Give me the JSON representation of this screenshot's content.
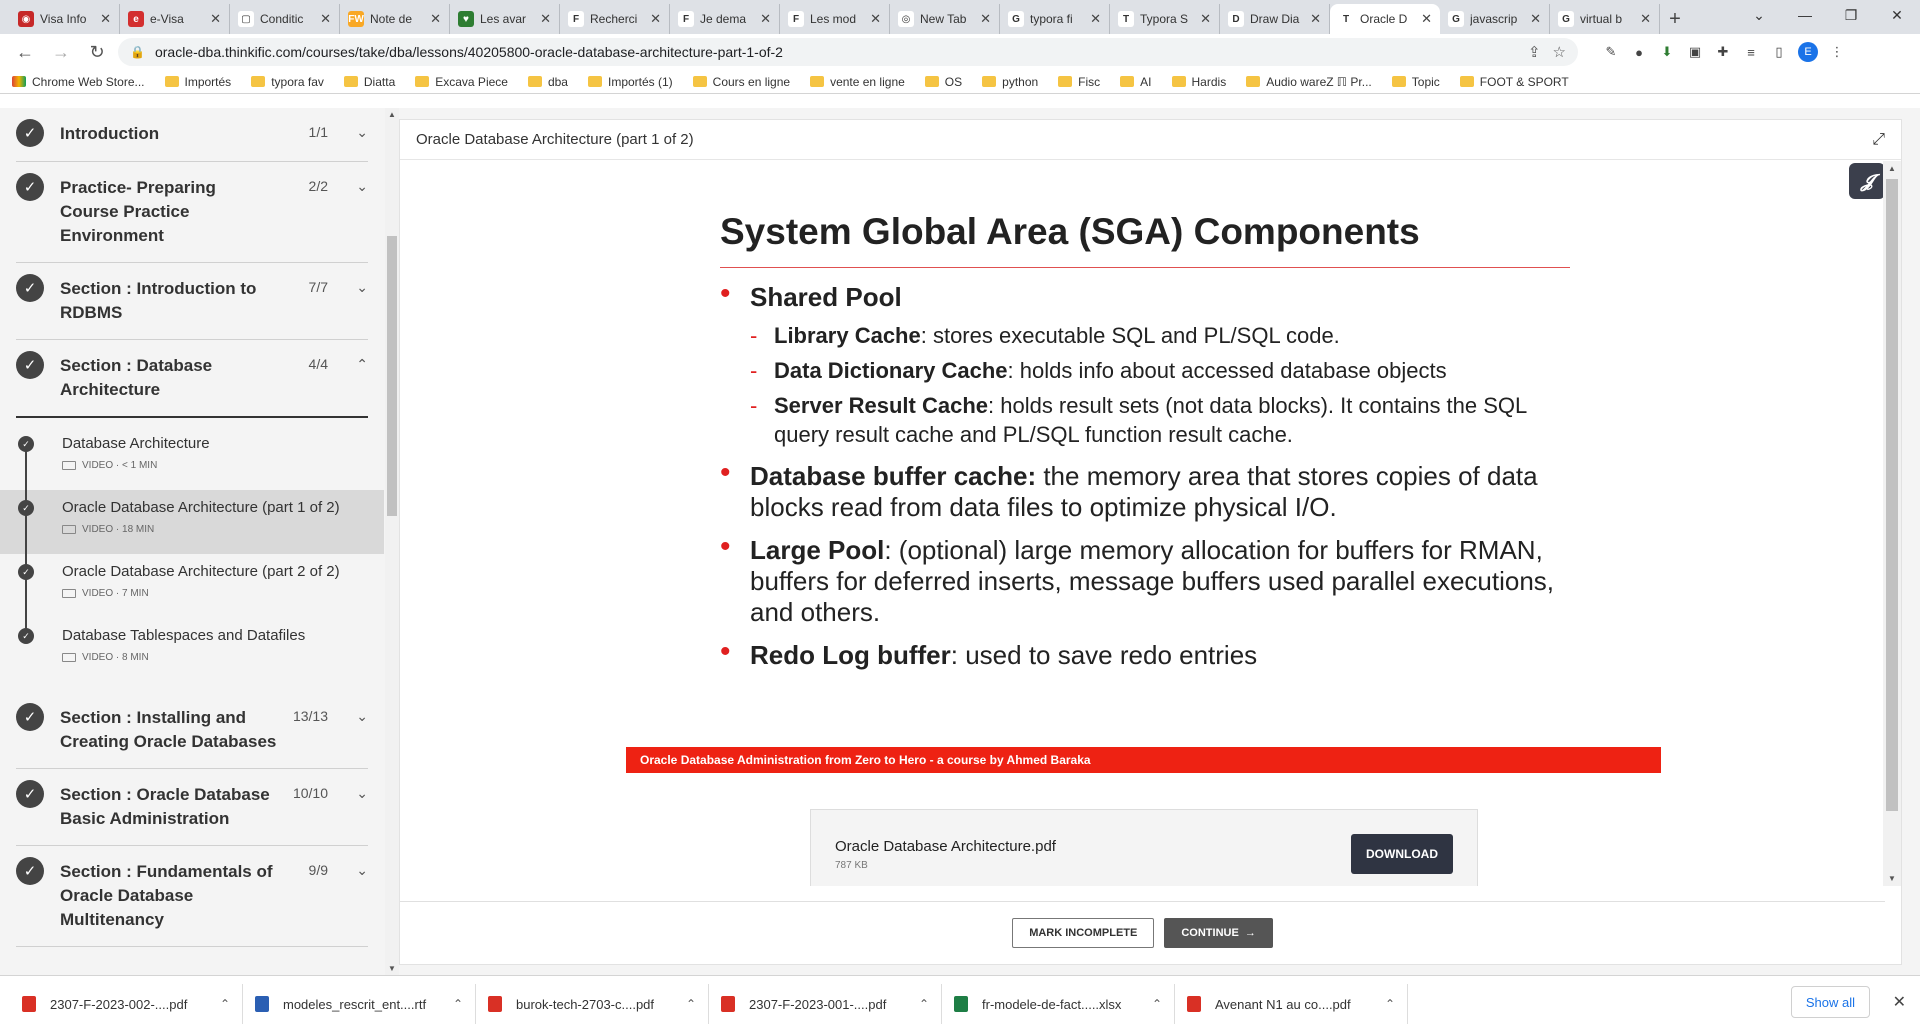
{
  "browser": {
    "tabs": [
      {
        "title": "Visa Info",
        "color": "#c62828",
        "glyph": "◉"
      },
      {
        "title": "e-Visa",
        "color": "#d32f2f",
        "glyph": "e"
      },
      {
        "title": "Conditic",
        "color": "#fff",
        "glyph": "▢"
      },
      {
        "title": "Note de",
        "color": "#f9a825",
        "glyph": "FW"
      },
      {
        "title": "Les avar",
        "color": "#2e7d32",
        "glyph": "♥"
      },
      {
        "title": "Recherci",
        "color": "#fff",
        "glyph": "F"
      },
      {
        "title": "Je dema",
        "color": "#fff",
        "glyph": "F"
      },
      {
        "title": "Les mod",
        "color": "#fff",
        "glyph": "F"
      },
      {
        "title": "New Tab",
        "color": "#fff",
        "glyph": "◎"
      },
      {
        "title": "typora fi",
        "color": "#fff",
        "glyph": "G"
      },
      {
        "title": "Typora S",
        "color": "#fff",
        "glyph": "T"
      },
      {
        "title": "Draw Dia",
        "color": "#fff",
        "glyph": "D"
      },
      {
        "title": "Oracle D",
        "color": "#fff",
        "glyph": "T",
        "active": true
      },
      {
        "title": "javascrip",
        "color": "#fff",
        "glyph": "G"
      },
      {
        "title": "virtual b",
        "color": "#fff",
        "glyph": "G"
      }
    ],
    "url": "oracle-dba.thinkific.com/courses/take/dba/lessons/40205800-oracle-database-architecture-part-1-of-2",
    "profile_initial": "E",
    "bookmarks": [
      "Chrome Web Store...",
      "Importés",
      "typora fav",
      "Diatta",
      "Excava Piece",
      "dba",
      "Importés (1)",
      "Cours en ligne",
      "vente en ligne",
      "OS",
      "python",
      "Fisc",
      "AI",
      "Hardis",
      "Audio wareZ ℿ Pr...",
      "Topic",
      "FOOT & SPORT"
    ]
  },
  "sidebar": {
    "sections": [
      {
        "title": "Introduction",
        "count": "1/1",
        "open": false
      },
      {
        "title": "Practice- Preparing Course Practice Environment",
        "count": "2/2",
        "open": false
      },
      {
        "title": "Section : Introduction to RDBMS",
        "count": "7/7",
        "open": false
      },
      {
        "title": "Section : Database Architecture",
        "count": "4/4",
        "open": true
      },
      {
        "title": "Section : Installing and Creating Oracle Databases",
        "count": "13/13",
        "open": false
      },
      {
        "title": "Section : Oracle Database Basic Administration",
        "count": "10/10",
        "open": false
      },
      {
        "title": "Section : Fundamentals of Oracle Database Multitenancy",
        "count": "9/9",
        "open": false
      }
    ],
    "lessons": [
      {
        "title": "Database Architecture",
        "meta": "VIDEO · < 1 MIN"
      },
      {
        "title": "Oracle Database Architecture (part 1 of 2)",
        "meta": "VIDEO · 18 MIN",
        "active": true
      },
      {
        "title": "Oracle Database Architecture (part 2 of 2)",
        "meta": "VIDEO · 7 MIN"
      },
      {
        "title": "Database Tablespaces and Datafiles",
        "meta": "VIDEO · 8 MIN"
      }
    ]
  },
  "content": {
    "header_title": "Oracle Database Architecture (part 1 of 2)",
    "slide": {
      "title": "System Global Area (SGA) Components",
      "shared_pool": "Shared Pool",
      "lib_cache_b": "Library Cache",
      "lib_cache_t": ": stores executable SQL and PL/SQL code.",
      "dict_cache_b": "Data Dictionary Cache",
      "dict_cache_t": ": holds info about accessed database objects",
      "result_cache_b": "Server Result Cache",
      "result_cache_t": ":  holds result sets (not data blocks). It contains the SQL query result cache and PL/SQL function result cache.",
      "buffer_b": "Database buffer cache:",
      "buffer_t": " the memory area that stores copies of data blocks read from data files to optimize physical I/O.",
      "large_b": "Large Pool",
      "large_t": ": (optional) large memory allocation for buffers for RMAN, buffers for deferred inserts, message buffers used parallel executions, and others.",
      "redo_b": "Redo Log buffer",
      "redo_t": ": used to save redo entries",
      "banner": "Oracle Database Administration from Zero to Hero -  a course by Ahmed Baraka"
    },
    "download": {
      "filename": "Oracle Database Architecture.pdf",
      "size": "787 KB",
      "button": "DOWNLOAD"
    },
    "mark_incomplete": "MARK INCOMPLETE",
    "continue": "CONTINUE"
  },
  "downloads_bar": {
    "items": [
      {
        "name": "2307-F-2023-002-....pdf",
        "type": "pdf"
      },
      {
        "name": "modeles_rescrit_ent....rtf",
        "type": "doc"
      },
      {
        "name": "burok-tech-2703-c....pdf",
        "type": "pdf"
      },
      {
        "name": "2307-F-2023-001-....pdf",
        "type": "pdf"
      },
      {
        "name": "fr-modele-de-fact.....xlsx",
        "type": "xls"
      },
      {
        "name": "Avenant N1 au co....pdf",
        "type": "pdf"
      }
    ],
    "show_all": "Show all"
  }
}
